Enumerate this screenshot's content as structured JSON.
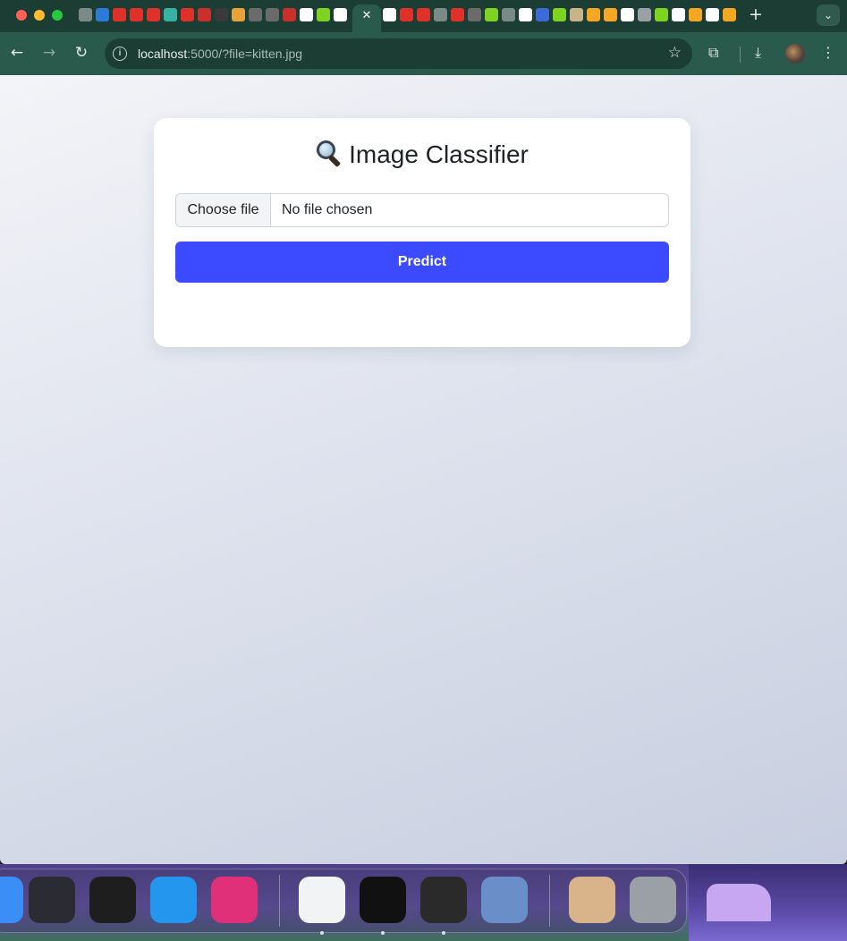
{
  "browser": {
    "active_tab_close": "✕",
    "new_tab_label": "+",
    "tab_search_label": "⌄",
    "url_host": "localhost",
    "url_rest": ":5000/?file=kitten.jpg",
    "back_glyph": "←",
    "forward_glyph": "→",
    "reload_glyph": "↻",
    "star_glyph": "☆",
    "extensions_glyph": "⧉",
    "download_glyph": "⤓",
    "menu_glyph": "⋮",
    "info_glyph": "i",
    "favicon_colors": [
      "#7a8a86",
      "#2b7bd6",
      "#e0302a",
      "#e0302a",
      "#e0302a",
      "#38b0a2",
      "#e0302a",
      "#c9302c",
      "#3a3a3a",
      "#e8a23a",
      "#6b6b6b",
      "#6b6b6b",
      "#c9302c",
      "#ffffff",
      "#7ed321",
      "#ffffff",
      "#ffffff",
      "#e0302a",
      "#e0302a",
      "#7a8a86",
      "#e0302a",
      "#6b6b6b",
      "#7ed321",
      "#7a8a86",
      "#ffffff",
      "#3b6bd6",
      "#7ed321",
      "#c9b48a",
      "#f5a623",
      "#f5a623",
      "#ffffff",
      "#9aa0a6",
      "#7ed321",
      "#ffffff",
      "#f5a623",
      "#ffffff",
      "#f5a623",
      "#ea4335"
    ]
  },
  "page": {
    "title": "Image Classifier",
    "title_icon": "magnifying-glass-icon",
    "choose_file_label": "Choose file",
    "no_file_text": "No file chosen",
    "predict_label": "Predict",
    "accent": "#3c4bff"
  },
  "dock": {
    "apps": [
      {
        "name": "finder",
        "color": "#3a8ef6"
      },
      {
        "name": "raycast",
        "color": "#2b2b33"
      },
      {
        "name": "figma",
        "color": "#1e1e1e"
      },
      {
        "name": "docker",
        "color": "#2496ed"
      },
      {
        "name": "intellij-idea",
        "color": "#e0307a"
      },
      {
        "name": "chrome",
        "color": "#f1f3f4"
      },
      {
        "name": "terminal",
        "color": "#111111"
      },
      {
        "name": "activity-ring",
        "color": "#2a2a2a"
      },
      {
        "name": "preview",
        "color": "#6a8fc8"
      },
      {
        "name": "kitten-image",
        "color": "#d9b48a"
      },
      {
        "name": "trash",
        "color": "#9aa0a6"
      }
    ]
  }
}
